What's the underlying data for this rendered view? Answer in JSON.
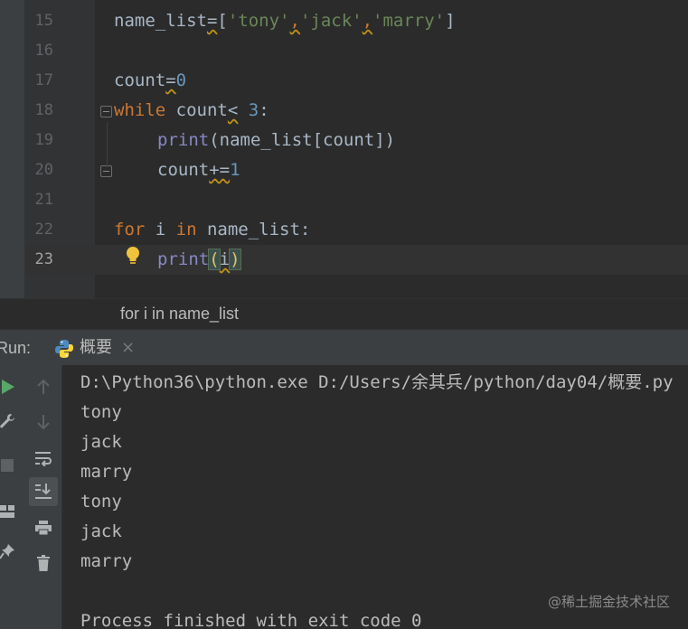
{
  "editor": {
    "lines": [
      {
        "num": "15"
      },
      {
        "num": "16"
      },
      {
        "num": "17"
      },
      {
        "num": "18"
      },
      {
        "num": "19"
      },
      {
        "num": "20"
      },
      {
        "num": "21"
      },
      {
        "num": "22"
      },
      {
        "num": "23"
      }
    ],
    "tokens": {
      "l15": {
        "name_list": "name_list",
        "eq": "=",
        "lb": "[",
        "s1": "'tony'",
        "c1": ",",
        "s2": "'jack'",
        "c2": ",",
        "s3": "'marry'",
        "rb": "]"
      },
      "l17": {
        "count": "count",
        "eq": "=",
        "zero": "0"
      },
      "l18": {
        "kw": "while",
        "rest": " count",
        "lt": "<",
        "sp": " ",
        "three": "3",
        "colon": ":"
      },
      "l19": {
        "fn": "print",
        "rest": "(name_list[count])"
      },
      "l20": {
        "count": "count",
        "op": "+=",
        "one": "1"
      },
      "l22": {
        "for": "for",
        "i": " i ",
        "in": "in",
        "rest": " name_list:"
      },
      "l23": {
        "fn": "print",
        "lp": "(",
        "i": "i",
        "rp": ")"
      }
    },
    "breadcrumb": "for i in name_list"
  },
  "run": {
    "label": "Run:",
    "tab_label": "概要",
    "tab_close": "×"
  },
  "console": {
    "lines": [
      "D:\\Python36\\python.exe D:/Users/余其兵/python/day04/概要.py",
      "tony",
      "jack",
      "marry",
      "tony",
      "jack",
      "marry",
      "",
      "Process finished with exit code 0"
    ]
  },
  "watermark": "@稀土掘金技术社区",
  "icons": [
    "lightbulb-icon",
    "python-file-icon",
    "run-icon",
    "wrench-icon",
    "stop-icon",
    "layout-icon",
    "pin-icon",
    "up-arrow-icon",
    "down-arrow-icon",
    "soft-wrap-icon",
    "scroll-to-end-icon",
    "print-icon",
    "trash-icon"
  ]
}
